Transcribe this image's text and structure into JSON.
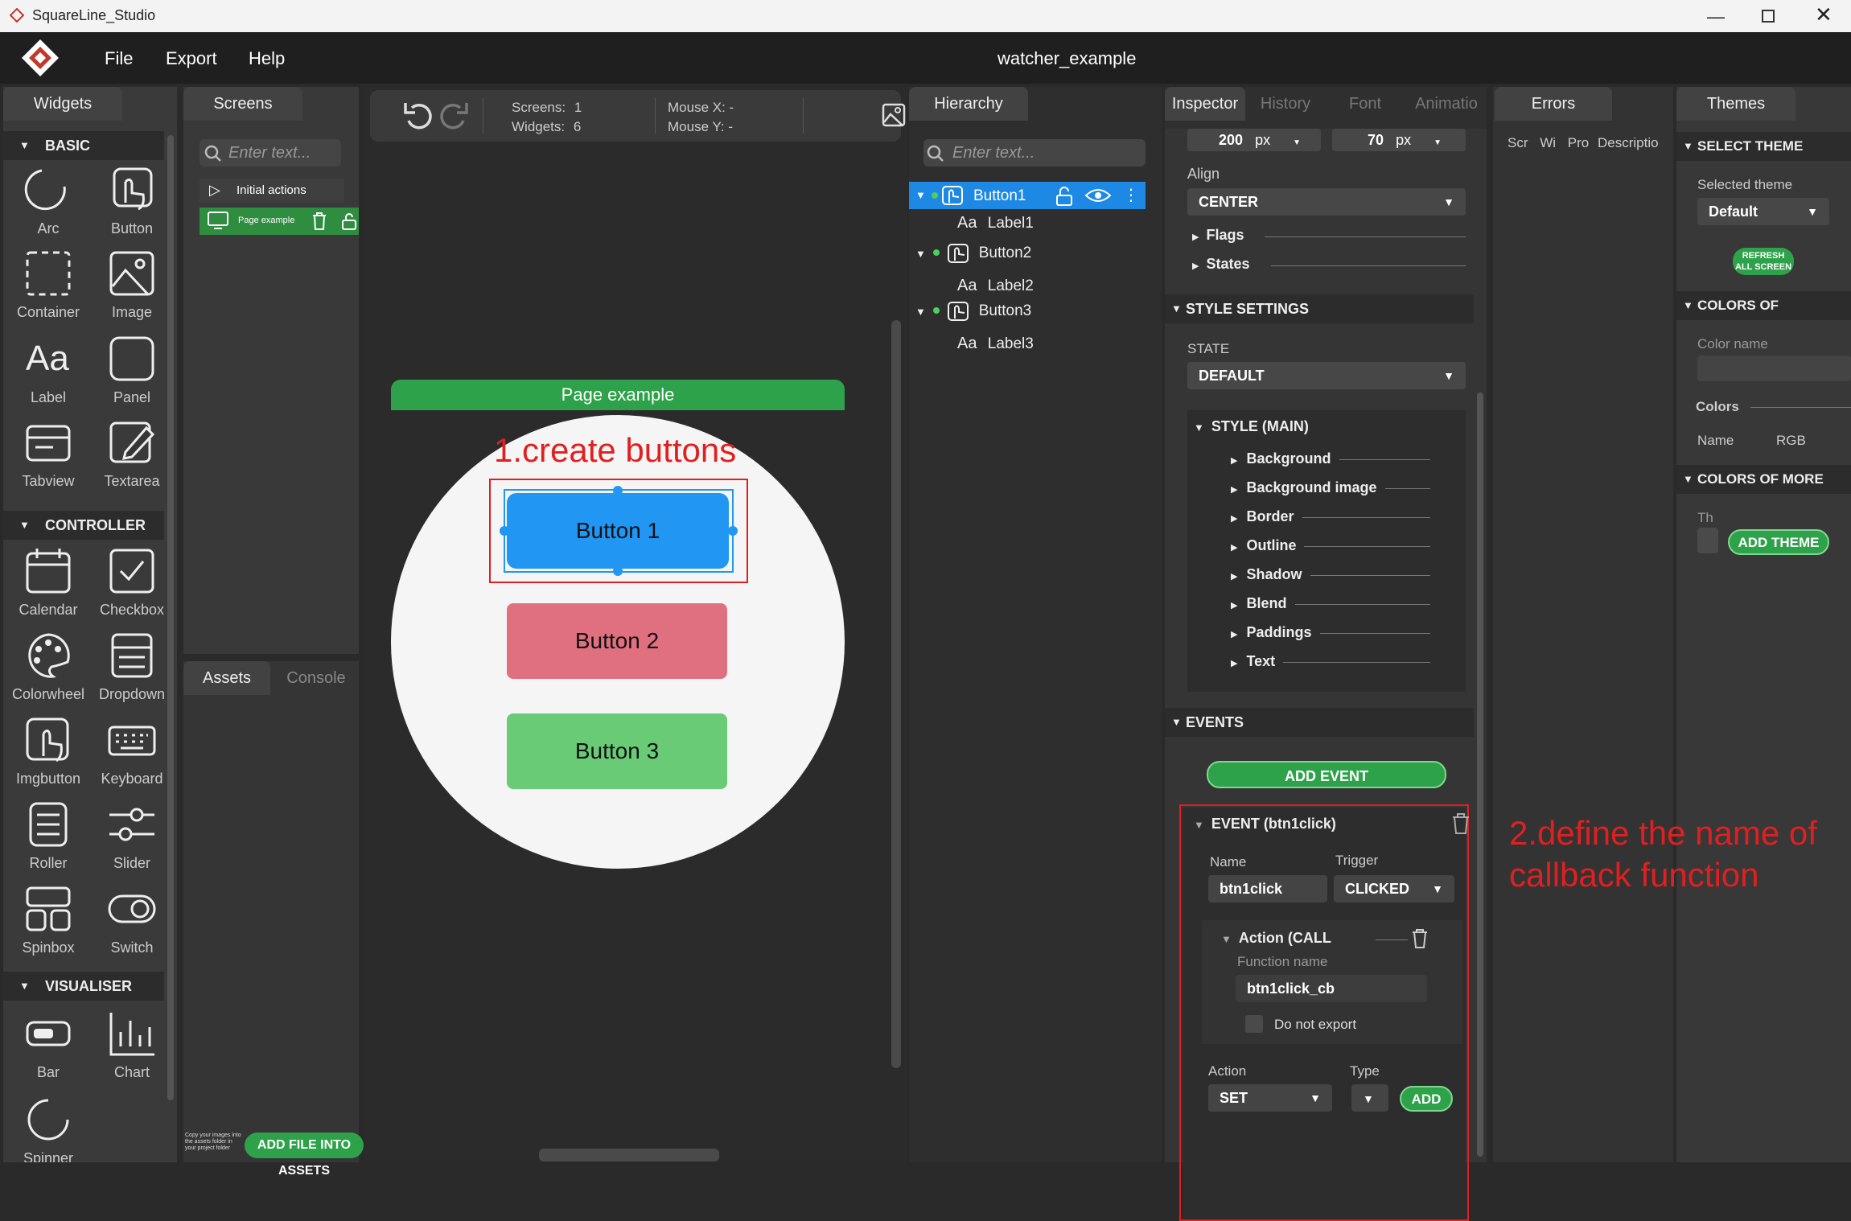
{
  "app": {
    "title": "SquareLine_Studio",
    "project": "watcher_example",
    "menu": [
      "File",
      "Export",
      "Help"
    ]
  },
  "tabs": {
    "widgets": "Widgets",
    "screens": "Screens",
    "hierarchy": "Hierarchy",
    "inspector": "Inspector",
    "history": "History",
    "font": "Font",
    "animation": "Animatio",
    "errors": "Errors",
    "themes": "Themes",
    "assets": "Assets",
    "console": "Console"
  },
  "widgets": {
    "basic": "BASIC",
    "controller": "CONTROLLER",
    "visualiser": "VISUALISER",
    "basic_items": [
      "Arc",
      "Button",
      "Container",
      "Image",
      "Label",
      "Panel",
      "Tabview",
      "Textarea"
    ],
    "controller_items": [
      "Calendar",
      "Checkbox",
      "Colorwheel",
      "Dropdown",
      "Imgbutton",
      "Keyboard",
      "Roller",
      "Slider",
      "Spinbox",
      "Switch"
    ],
    "visualiser_items": [
      "Bar",
      "Chart",
      "Spinner"
    ]
  },
  "screens": {
    "search_placeholder": "Enter text...",
    "initial_actions": "Initial actions",
    "screen_item": "Page example"
  },
  "assets": {
    "hint": "Copy your images into the assets folder in your project folder",
    "add_button": "ADD FILE INTO ASSETS"
  },
  "toolbar": {
    "screens_label": "Screens:",
    "screens_val": "1",
    "widgets_label": "Widgets:",
    "widgets_val": "6",
    "mousex_label": "Mouse X:",
    "mousex_val": "-",
    "mousey_label": "Mouse Y:",
    "mousey_val": "-"
  },
  "canvas": {
    "screen_title": "Page example",
    "annotation1": "1.create buttons",
    "button1": "Button 1",
    "button2": "Button 2",
    "button3": "Button 3",
    "annotation2": "2.define the name of callback function"
  },
  "hierarchy": {
    "search_placeholder": "Enter text...",
    "items": [
      {
        "name": "Button1",
        "child": "Label1"
      },
      {
        "name": "Button2",
        "child": "Label2"
      },
      {
        "name": "Button3",
        "child": "Label3"
      }
    ]
  },
  "inspector": {
    "width_val": "200",
    "height_val": "70",
    "unit": "px",
    "align_label": "Align",
    "align_val": "CENTER",
    "flags": "Flags",
    "states": "States",
    "style_settings": "STYLE SETTINGS",
    "state_label": "STATE",
    "state_val": "DEFAULT",
    "style_main": "STYLE (MAIN)",
    "style_items": [
      "Background",
      "Background image",
      "Border",
      "Outline",
      "Shadow",
      "Blend",
      "Paddings",
      "Text"
    ],
    "events": "EVENTS",
    "add_event": "ADD EVENT",
    "event_title": "EVENT (btn1click)",
    "name_label": "Name",
    "name_val": "btn1click",
    "trigger_label": "Trigger",
    "trigger_val": "CLICKED",
    "action_call": "Action (CALL",
    "function_label": "Function name",
    "function_val": "btn1click_cb",
    "do_not_export": "Do not export",
    "action_label": "Action",
    "action_val": "SET",
    "type_label": "Type",
    "add": "ADD"
  },
  "errors": {
    "columns": [
      "Scr",
      "Wi",
      "Pro",
      "Descriptio"
    ]
  },
  "themes": {
    "select_theme": "SELECT THEME",
    "selected_label": "Selected theme",
    "selected_val": "Default",
    "refresh": "REFRESH ALL SCREEN",
    "colors_of": "COLORS OF",
    "color_name_label": "Color name",
    "colors": "Colors",
    "name_col": "Name",
    "rgb_col": "RGB",
    "colors_of_more": "COLORS OF MORE",
    "th": "Th",
    "add_theme": "ADD THEME"
  },
  "colors": {
    "accent_blue": "#2196f3",
    "green": "#2ea24a",
    "red_annotation": "#e02020",
    "button2": "#e07080",
    "button3": "#6acb76"
  }
}
